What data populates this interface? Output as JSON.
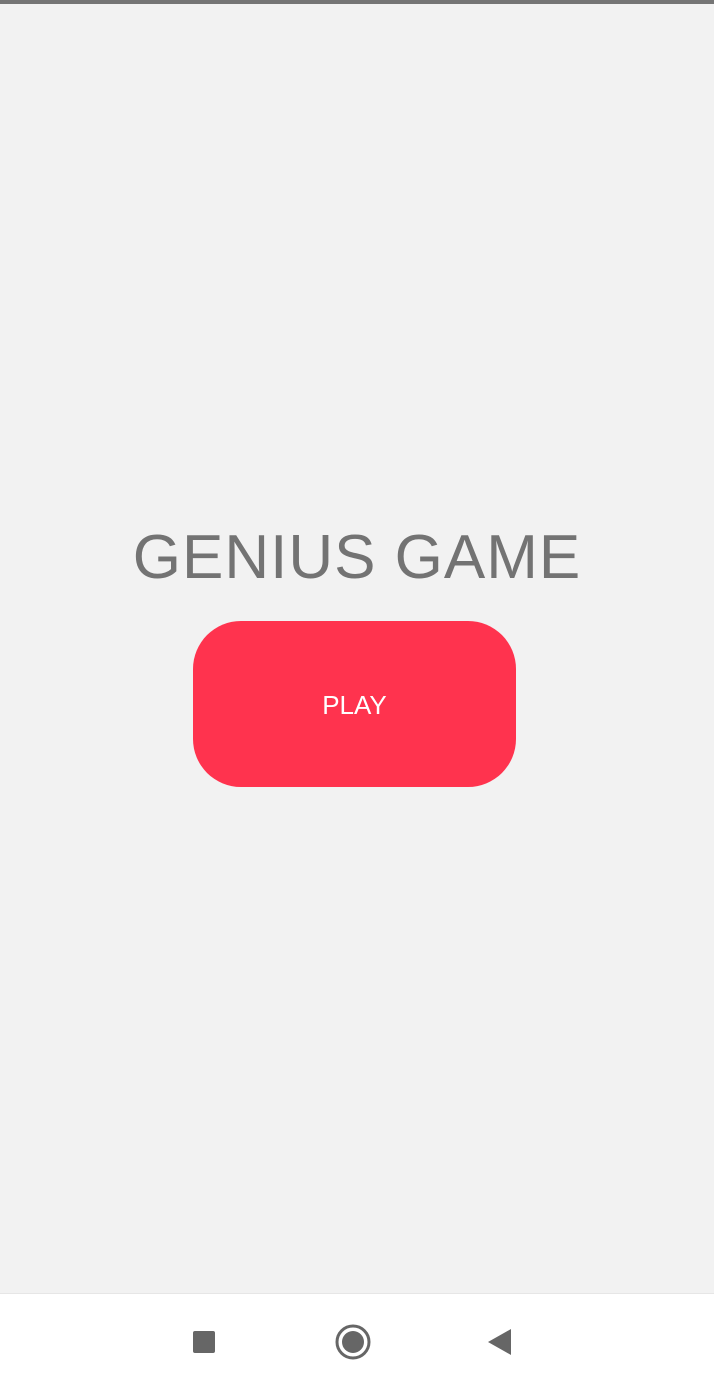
{
  "app": {
    "title": "GENIUS GAME",
    "play_label": "PLAY"
  },
  "colors": {
    "background": "#f2f2f2",
    "title": "#737373",
    "accent": "#ff334e",
    "button_text": "#ffffff",
    "nav_icon": "#666666"
  },
  "navigation": {
    "recents_icon": "square-recents-icon",
    "home_icon": "circle-home-icon",
    "back_icon": "triangle-back-icon"
  }
}
